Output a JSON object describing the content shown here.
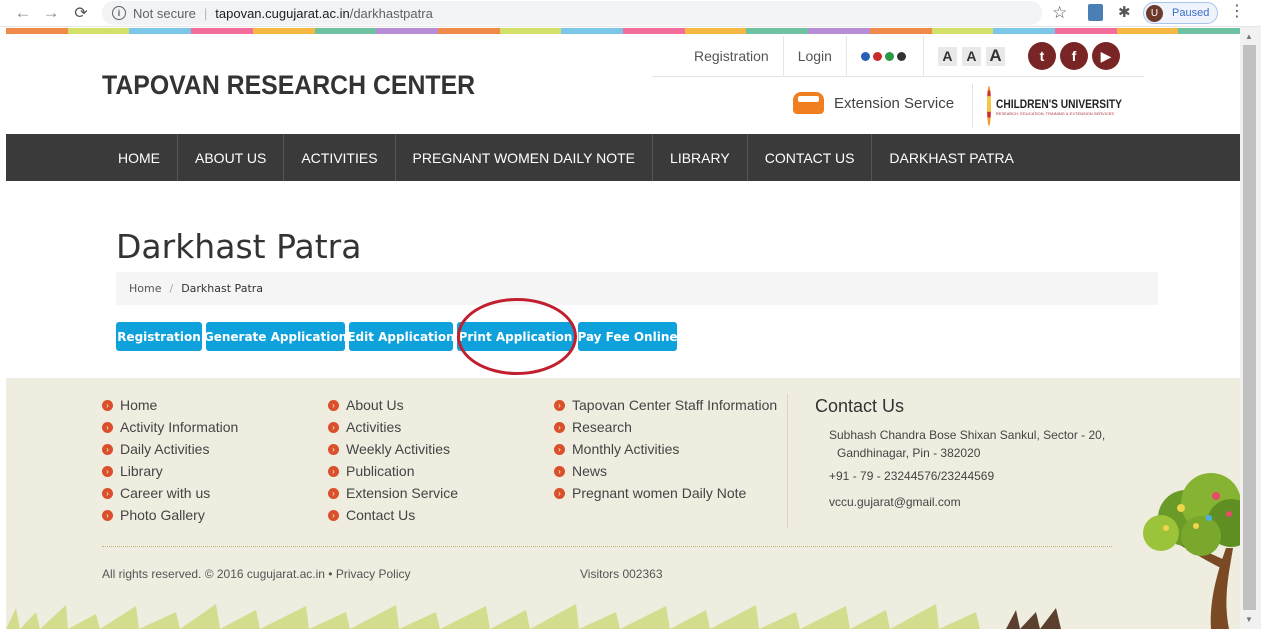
{
  "browser": {
    "not_secure": "Not secure",
    "url_host": "tapovan.cugujarat.ac.in",
    "url_path": "/darkhastpatra",
    "profile_initial": "U",
    "profile_status": "Paused"
  },
  "strip_colors": [
    "#f08a4b",
    "#d5e06a",
    "#7cc6e8",
    "#f26d9b",
    "#f5b843",
    "#6ec2a2",
    "#b78ed6",
    "#f08a4b",
    "#d5e06a",
    "#7cc6e8",
    "#f26d9b",
    "#f5b843",
    "#6ec2a2",
    "#b78ed6",
    "#f08a4b",
    "#d5e06a",
    "#7cc6e8",
    "#f26d9b",
    "#f5b843",
    "#6ec2a2"
  ],
  "header": {
    "site_title": "TAPOVAN RESEARCH CENTER",
    "registration": "Registration",
    "login": "Login",
    "dot_colors": [
      "#2a5fb8",
      "#c92b2b",
      "#2a9a46",
      "#333333"
    ],
    "font_sizes": [
      "A",
      "A",
      "A"
    ],
    "social_icons": [
      "twitter-icon",
      "facebook-icon",
      "youtube-icon"
    ],
    "social_glyphs": [
      "t",
      "f",
      "▶"
    ],
    "extension_service": "Extension Service",
    "cu_name": "CHILDREN'S UNIVERSITY",
    "cu_sub": "RESEARCH, EDUCATION, TRAINING & EXTENSION SERVICES"
  },
  "nav": [
    {
      "id": "home",
      "label": "HOME"
    },
    {
      "id": "about-us",
      "label": "ABOUT US"
    },
    {
      "id": "activities",
      "label": "ACTIVITIES"
    },
    {
      "id": "pregnant-women-daily-note",
      "label": "PREGNANT WOMEN DAILY NOTE"
    },
    {
      "id": "library",
      "label": "LIBRARY"
    },
    {
      "id": "contact-us",
      "label": "CONTACT US"
    },
    {
      "id": "darkhast-patra",
      "label": "DARKHAST PATRA"
    }
  ],
  "page": {
    "title": "Darkhast Patra",
    "breadcrumb_home": "Home",
    "breadcrumb_sep": "/",
    "breadcrumb_current": "Darkhast Patra"
  },
  "actions": {
    "registration": "Registration",
    "generate": "Generate Application",
    "edit": "Edit Application",
    "print": "Print Application",
    "pay": "Pay Fee Online"
  },
  "footer": {
    "col1": [
      "Home",
      "Activity Information",
      "Daily Activities",
      "Library",
      "Career with us",
      "Photo Gallery"
    ],
    "col2": [
      "About Us",
      "Activities",
      "Weekly Activities",
      "Publication",
      "Extension Service",
      "Contact Us"
    ],
    "col3": [
      "Tapovan Center Staff Information",
      "Research",
      "Monthly Activities",
      "News",
      "Pregnant women Daily Note"
    ],
    "contact_title": "Contact Us",
    "address_line1": "Subhash Chandra Bose Shixan Sankul, Sector - 20,",
    "address_line2": "Gandhinagar, Pin - 382020",
    "phone": "+91 - 79 - 23244576/23244569",
    "email": "vccu.gujarat@gmail.com",
    "copyright": "All rights reserved. © 2016 cugujarat.ac.in • Privacy Policy",
    "visitors": "Visitors 002363"
  }
}
